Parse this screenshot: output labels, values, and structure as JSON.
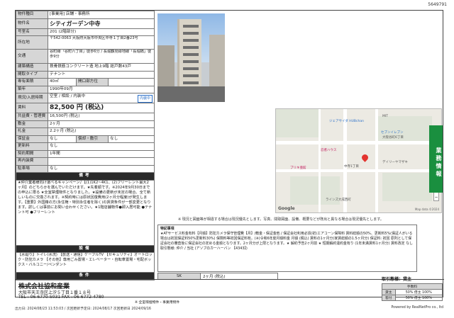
{
  "doc_id": "5649791",
  "property": {
    "rows": [
      {
        "label": "物件種目",
        "value": "[事業用] 店舗・事務所"
      },
      {
        "label": "物件名",
        "value": "シティガーデン中寺"
      },
      {
        "label": "号室名",
        "value": "201 (2階部分)"
      },
      {
        "label": "所在地",
        "value": "〒542-0063  大阪府大阪市中央区中寺１丁目2番23号"
      },
      {
        "label": "交通",
        "value": "谷町線「谷町六丁目」徒歩6分 / 長堀鶴見緑地線「長堀橋」徒歩9分"
      },
      {
        "label": "建築構造",
        "value": "鉄骨鉄筋コンクリート造 地上9階 総戸数43戸"
      },
      {
        "label": "間取タイプ",
        "value": "テナント"
      },
      {
        "label": "専有面積",
        "value": "40㎡"
      },
      {
        "label": "築年",
        "value": "1990年09月"
      },
      {
        "label": "現況/入居時期",
        "value": "空室 / 相談 / 内装中"
      },
      {
        "label": "賃料",
        "value": "82,500 円 (税込)"
      },
      {
        "label": "共益費・管理費",
        "value": "16,500円 (税込)"
      },
      {
        "label": "敷金",
        "value": "2ヶ月"
      },
      {
        "label": "礼金",
        "value": "2.2ヶ月 (税込)"
      },
      {
        "label": "保証金",
        "value": "なし"
      },
      {
        "label": "更新料",
        "value": "なし"
      },
      {
        "label": "契約期間",
        "value": "1年間"
      },
      {
        "label": "再内装費",
        "value": ""
      },
      {
        "label": "駐車場",
        "value": "なし"
      }
    ],
    "window_label": "開口部方位",
    "window_value": "",
    "shokyaku_label": "償却・敷引",
    "shokyaku_value": "なし",
    "stamp": "内装中",
    "remarks_title": "備考",
    "remarks": "★仲介業者様向け選べるキャンペーン♪【(1)1K2~4K1、(2)フリーレント最大2ヶ月】のどちらかを選んでいただけます。★先着順です。※2024年9月30日までの申込に限る ★全室禁煙物件となりました。★設備の更新が未定の場合、全て新しいものに交換されます。※契約時には原状回復費用(2ヶ月分程度)が発生します。【重要】外国籍の方(永住権・特別永住者を除く)の賃貸条件が一部変更となります。詳しくは事前にお問い合わせください。★1階店舗物件●即入居可能 ●テナント可 ●フリーレント",
    "facilities_title": "設備",
    "facilities": "【水廻り】トイレ(水洗) 【放送・通信】ケーブルTV 【セキュリティ】オートロック・防犯カメラ 【その他】専用ごみ置場・エレベーター・自転車置場・宅配ボックス・バルコニー/ペンダント",
    "conditions_title": "条件",
    "conditions": ""
  },
  "note": "※ 現況と図面等が相違する場合は現況優先とします。写真、間取図面、設備、概要などが既出と異なる場合は現況優先とします。",
  "detail": {
    "title": "特記事項",
    "text": "★ATサービス料金有料【月額】防犯カメラ保守管理費【月】/敷金・保証金他 / 保証会社利用必須(初)エアコーン保障料 賃料総額の50%、更新料5%(保証人がいる場合は初回保証料50%更新料30%) 保険料等初回保証料有。(※)令和6年度月額料金 月額 (税込) 賃料の1ヶ月分(家賃総額の1.5ヶ月分) 保証料: 初回 原則として保証会社の審査後に保証会社の定める金額となります。2ヶ月分が上限となります。★ 解約予告2ヶ月前 ★ 短期解約違約金有り (1年未満賃料1ヶ月分) 賃料改定 なし",
    "agent": "取引態様: 仲介 / 当社 (アソブのカーハーバン 【4343】)"
  },
  "detail_row": {
    "label": "SK",
    "value": "2ヶ月 (税込)"
  },
  "tab": "業務情報",
  "company": {
    "name": "株式会社協和産業",
    "address": "大阪市天王寺区上汐５丁目１番１８号",
    "tel": "TEL : 06-6770-5031    FAX : 06-6772-4780"
  },
  "deal": {
    "label": "取引態様：貸主",
    "h": "手数料",
    "row1_k": "貸主",
    "row1_v": "50% 借主 100%",
    "row2_k": "客付",
    "row2_v": "50% 借主 100%"
  },
  "below_note": "※ 全室喫煙物件・事業用物件",
  "footer_left": "出力日: 2024/08/23 11:53:03 / 次回更新予定日: 2024/08/17 次回更新日 2024/09/16",
  "footer_right": "Powered by RealNetPro co., ltd",
  "map": {
    "labels": [
      "ジェアサイダ HUBchan",
      "MIT",
      "セブンイレブン",
      "大阪谷町6丁目",
      "忍者ハウス",
      "ブリキ亜館",
      "デイリーヤマザキ",
      "中寺1丁目",
      "ラインズ大成西町",
      "Google",
      "Map data ©2024"
    ]
  }
}
